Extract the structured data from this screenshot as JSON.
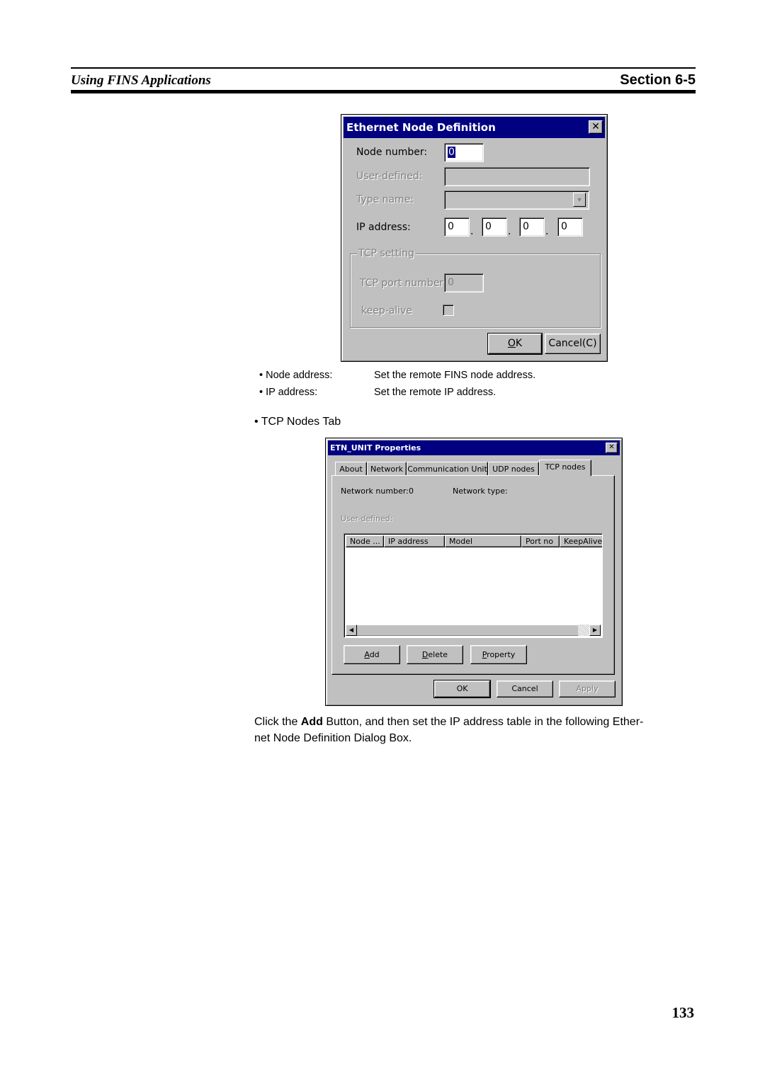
{
  "header": {
    "section_title": "Using FINS Applications",
    "section_number": "Section 6-5"
  },
  "node_dialog": {
    "title": "Ethernet Node Definition",
    "close_icon": "close-icon",
    "node_number_label": "Node number:",
    "node_number_value": "0",
    "user_defined_label": "User-defined:",
    "user_defined_value": "",
    "type_name_label": "Type name:",
    "type_name_value": "",
    "ip_address_label": "IP address:",
    "ip_octets": [
      "0",
      "0",
      "0",
      "0"
    ],
    "ip_separator": ".",
    "tcp_group_title": "TCP setting",
    "tcp_port_label": "TCP port number",
    "tcp_port_value": "0",
    "keep_alive_label": "keep-alive",
    "keep_alive_checked": false,
    "ok_label": "OK",
    "ok_mnemonic": "O",
    "cancel_label": "Cancel(C)"
  },
  "captions": [
    {
      "term": "Node address:",
      "desc": "Set the remote FINS node address."
    },
    {
      "term": "IP address:",
      "desc": "Set the remote IP address."
    }
  ],
  "bullet": "•",
  "subheading": "TCP Nodes Tab",
  "props_dialog": {
    "title": "ETN_UNIT Properties",
    "tabs": [
      {
        "label": "About",
        "active": false
      },
      {
        "label": "Network",
        "active": false
      },
      {
        "label": "Communication Unit",
        "active": false
      },
      {
        "label": "UDP nodes",
        "active": false
      },
      {
        "label": "TCP nodes",
        "active": true
      }
    ],
    "network_number_label": "Network number:",
    "network_number_value": "0",
    "network_type_label": "Network type:",
    "network_type_value": "",
    "user_defined_label": "User-defined:",
    "list_columns": [
      "Node ...",
      "IP address",
      "Model",
      "Port no",
      "KeepAlive"
    ],
    "list_rows": [],
    "add_label": "Add",
    "delete_label": "Delete",
    "property_label": "Property",
    "ok_label": "OK",
    "cancel_label": "Cancel",
    "apply_label": "Apply"
  },
  "instruction": {
    "prefix": "Click the ",
    "bold": "Add",
    "line1_rest": " Button, and then set the IP address table in the following Ether-",
    "line2": "net Node Definition Dialog Box."
  },
  "page_number": "133"
}
